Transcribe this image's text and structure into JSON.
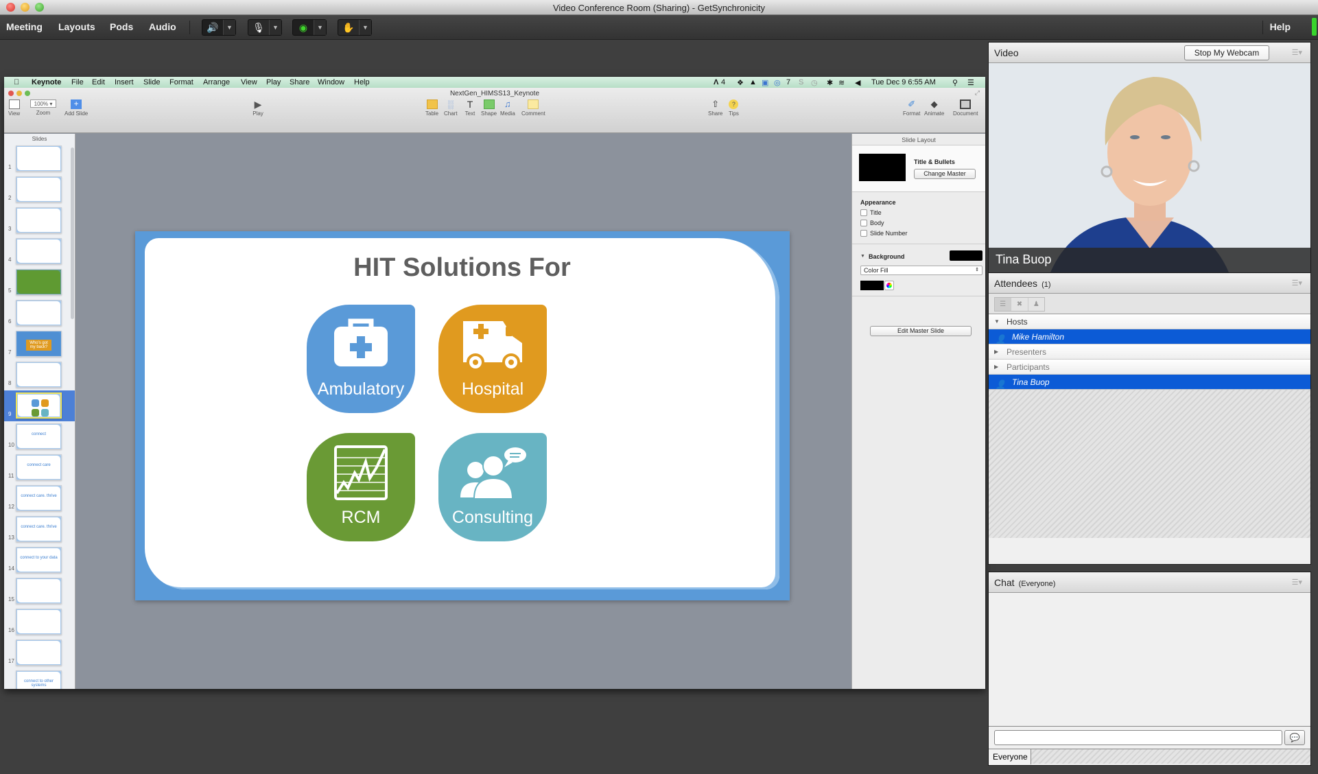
{
  "window": {
    "title": "Video Conference Room (Sharing) - GetSynchronicity"
  },
  "appbar": {
    "menus": [
      "Meeting",
      "Layouts",
      "Pods",
      "Audio"
    ],
    "controls": [
      {
        "name": "speaker",
        "icon": "speaker-icon",
        "active": true
      },
      {
        "name": "microphone",
        "icon": "microphone-icon",
        "active": false
      },
      {
        "name": "webcam",
        "icon": "webcam-icon",
        "active": true
      },
      {
        "name": "raise-hand",
        "icon": "raise-hand-icon",
        "active": false
      }
    ],
    "help": "Help"
  },
  "mac_menubar": {
    "app": "Keynote",
    "menus": [
      "File",
      "Edit",
      "Insert",
      "Slide",
      "Format",
      "Arrange",
      "View",
      "Play",
      "Share",
      "Window",
      "Help"
    ],
    "status": {
      "adobe_count": "4",
      "cc_count": "7",
      "datetime": "Tue Dec 9  6:55 AM"
    }
  },
  "keynote": {
    "doc_title": "NextGen_HIMSS13_Keynote",
    "toolbar": {
      "view": "View",
      "zoom_value": "100%",
      "zoom": "Zoom",
      "add_slide": "Add Slide",
      "play": "Play",
      "table": "Table",
      "chart": "Chart",
      "text": "Text",
      "shape": "Shape",
      "media": "Media",
      "comment": "Comment",
      "share": "Share",
      "tips": "Tips",
      "format": "Format",
      "animate": "Animate",
      "document": "Document"
    },
    "slides_header": "Slides",
    "selected_slide": 9,
    "thumbnails": [
      {
        "n": "1",
        "text": "",
        "style": "plain"
      },
      {
        "n": "2",
        "text": "",
        "style": "plain"
      },
      {
        "n": "3",
        "text": "",
        "style": "plain"
      },
      {
        "n": "4",
        "text": "",
        "style": "plain"
      },
      {
        "n": "5",
        "text": "",
        "style": "green"
      },
      {
        "n": "6",
        "text": "",
        "style": "plain"
      },
      {
        "n": "7",
        "text": "Who's got my back?",
        "style": "blue"
      },
      {
        "n": "8",
        "text": "",
        "style": "plain"
      },
      {
        "n": "9",
        "text": "",
        "style": "sel"
      },
      {
        "n": "10",
        "text": "connect",
        "style": "plain"
      },
      {
        "n": "11",
        "text": "connect care",
        "style": "plain"
      },
      {
        "n": "12",
        "text": "connect care. thrive",
        "style": "plain"
      },
      {
        "n": "13",
        "text": "connect care. thrive",
        "style": "plain"
      },
      {
        "n": "14",
        "text": "connect to your data",
        "style": "plain"
      },
      {
        "n": "15",
        "text": "",
        "style": "plain"
      },
      {
        "n": "16",
        "text": "",
        "style": "plain"
      },
      {
        "n": "17",
        "text": "",
        "style": "plain"
      },
      {
        "n": "",
        "text": "connect to other systems",
        "style": "plain"
      }
    ],
    "slide": {
      "title": "HIT Solutions For",
      "tiles": [
        {
          "label": "Ambulatory",
          "color": "#5a9ad8",
          "icon": "medical-bag-icon"
        },
        {
          "label": "Hospital",
          "color": "#e09a1f",
          "icon": "ambulance-icon"
        },
        {
          "label": "RCM",
          "color": "#6a9a35",
          "icon": "chart-icon"
        },
        {
          "label": "Consulting",
          "color": "#68b4c3",
          "icon": "people-chat-icon"
        }
      ]
    },
    "inspector": {
      "header": "Slide Layout",
      "master_name": "Title & Bullets",
      "change_master": "Change Master",
      "appearance": "Appearance",
      "checkboxes": [
        {
          "label": "Title",
          "checked": false
        },
        {
          "label": "Body",
          "checked": false
        },
        {
          "label": "Slide Number",
          "checked": false
        }
      ],
      "background": "Background",
      "fill_select": "Color Fill",
      "edit_master": "Edit Master Slide"
    }
  },
  "video_pod": {
    "title": "Video",
    "stop_webcam": "Stop My Webcam",
    "participant_name": "Tina Buop"
  },
  "attendees_pod": {
    "title": "Attendees",
    "count": "(1)",
    "rows": [
      {
        "type": "group",
        "label": "Hosts",
        "expanded": true
      },
      {
        "type": "user",
        "label": "Mike Hamilton"
      },
      {
        "type": "group",
        "label": "Presenters",
        "expanded": false
      },
      {
        "type": "group",
        "label": "Participants",
        "expanded": false
      },
      {
        "type": "user",
        "label": "Tina Buop"
      }
    ]
  },
  "chat_pod": {
    "title": "Chat",
    "scope": "(Everyone)",
    "input_value": "",
    "tab": "Everyone"
  }
}
